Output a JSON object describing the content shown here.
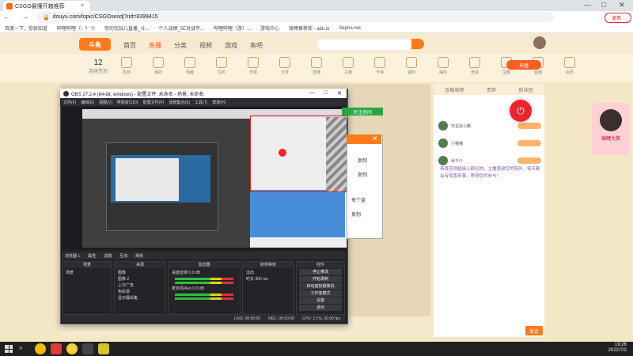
{
  "browser": {
    "tab_title": "CSGO最懂开箱推荐",
    "tab_close": "×",
    "url": "douyu.com/topic/CSGOsesdj?rid=8399415",
    "update_label": "更新 :",
    "window_controls": {
      "min": "—",
      "max": "□",
      "close": "✕"
    },
    "nav": "← → C",
    "bookmarks": [
      "百度一下，你就知道",
      "哔哩哔哩（'- '）つ",
      "你的完玩儿直播_斗...",
      "个人战绩_5E对战平...",
      "哔哩哔哩（游）...",
      "游戏中心",
      "微博推荐库 - abit.io",
      "Sepha.net"
    ]
  },
  "douyu": {
    "logo": "斗鱼",
    "nav": [
      "首页",
      "直播",
      "分类",
      "视频",
      "游戏",
      "鱼吧"
    ],
    "count": "12",
    "count_label": "连续签到",
    "tools": [
      "签到",
      "我的",
      "电脑",
      "任务",
      "日报",
      "分享",
      "直播",
      "主播",
      "卡券",
      "福利",
      "抽奖",
      "竞猜",
      "宝箱",
      "客服",
      "会员"
    ],
    "charge": "充值",
    "side_tabs": [
      "贡献周榜",
      "贵宾",
      "粉丝团"
    ],
    "ranks": [
      "无名鼠小霸",
      "小猫猫",
      "秋千少"
    ],
    "chat": "恭喜获得超级火箭礼物，主播感谢您的陪伴，每天都会有惊喜来袭，等待您的参与！",
    "send": "发送",
    "ad_text": "锦鲤大奖"
  },
  "obs": {
    "title": "OBS 27.2.4 (64-bit, windows) - 配置文件: 未命名 - 场景: 未命名",
    "menu": [
      "文件(F)",
      "编辑(E)",
      "视图(V)",
      "停靠窗口(D)",
      "配置文件(P)",
      "场景集合(S)",
      "工具(T)",
      "帮助(H)"
    ],
    "docks_bar": [
      "浏览器 1",
      "属性",
      "滤镜",
      "互动",
      "刷新"
    ],
    "scenes_h": "场景",
    "scenes": [
      "场景"
    ],
    "sources_h": "来源",
    "sources": [
      "图像",
      "图像 2",
      "上次广告",
      "色彩源",
      "显示器采集"
    ],
    "mixer_h": "混音器",
    "mixer": [
      "桌面音频",
      "麦克风/Aux"
    ],
    "mixer_db": [
      "0.0 dB",
      "0.0 dB"
    ],
    "trans_h": "转场特效",
    "trans_fade": "淡出",
    "trans_dur_label": "时长",
    "trans_dur": "300 ms",
    "ctrl_h": "控件",
    "ctrl": [
      "停止推流",
      "开始录制",
      "启动虚拟摄像机",
      "工作室模式",
      "设置",
      "退出"
    ],
    "status": [
      "LIVE: 00:00:00",
      "REC: 00:00:00",
      "CPU: 2.1%, 30.00 fps"
    ]
  },
  "preview": {
    "green_btn": "关注房间",
    "dialog_a": "复制",
    "dialog_b": "复制",
    "dialog_c": "每个盘",
    "dialog_d": "复制"
  },
  "taskbar": {
    "time": "19:26",
    "date": "2022/7/2"
  }
}
